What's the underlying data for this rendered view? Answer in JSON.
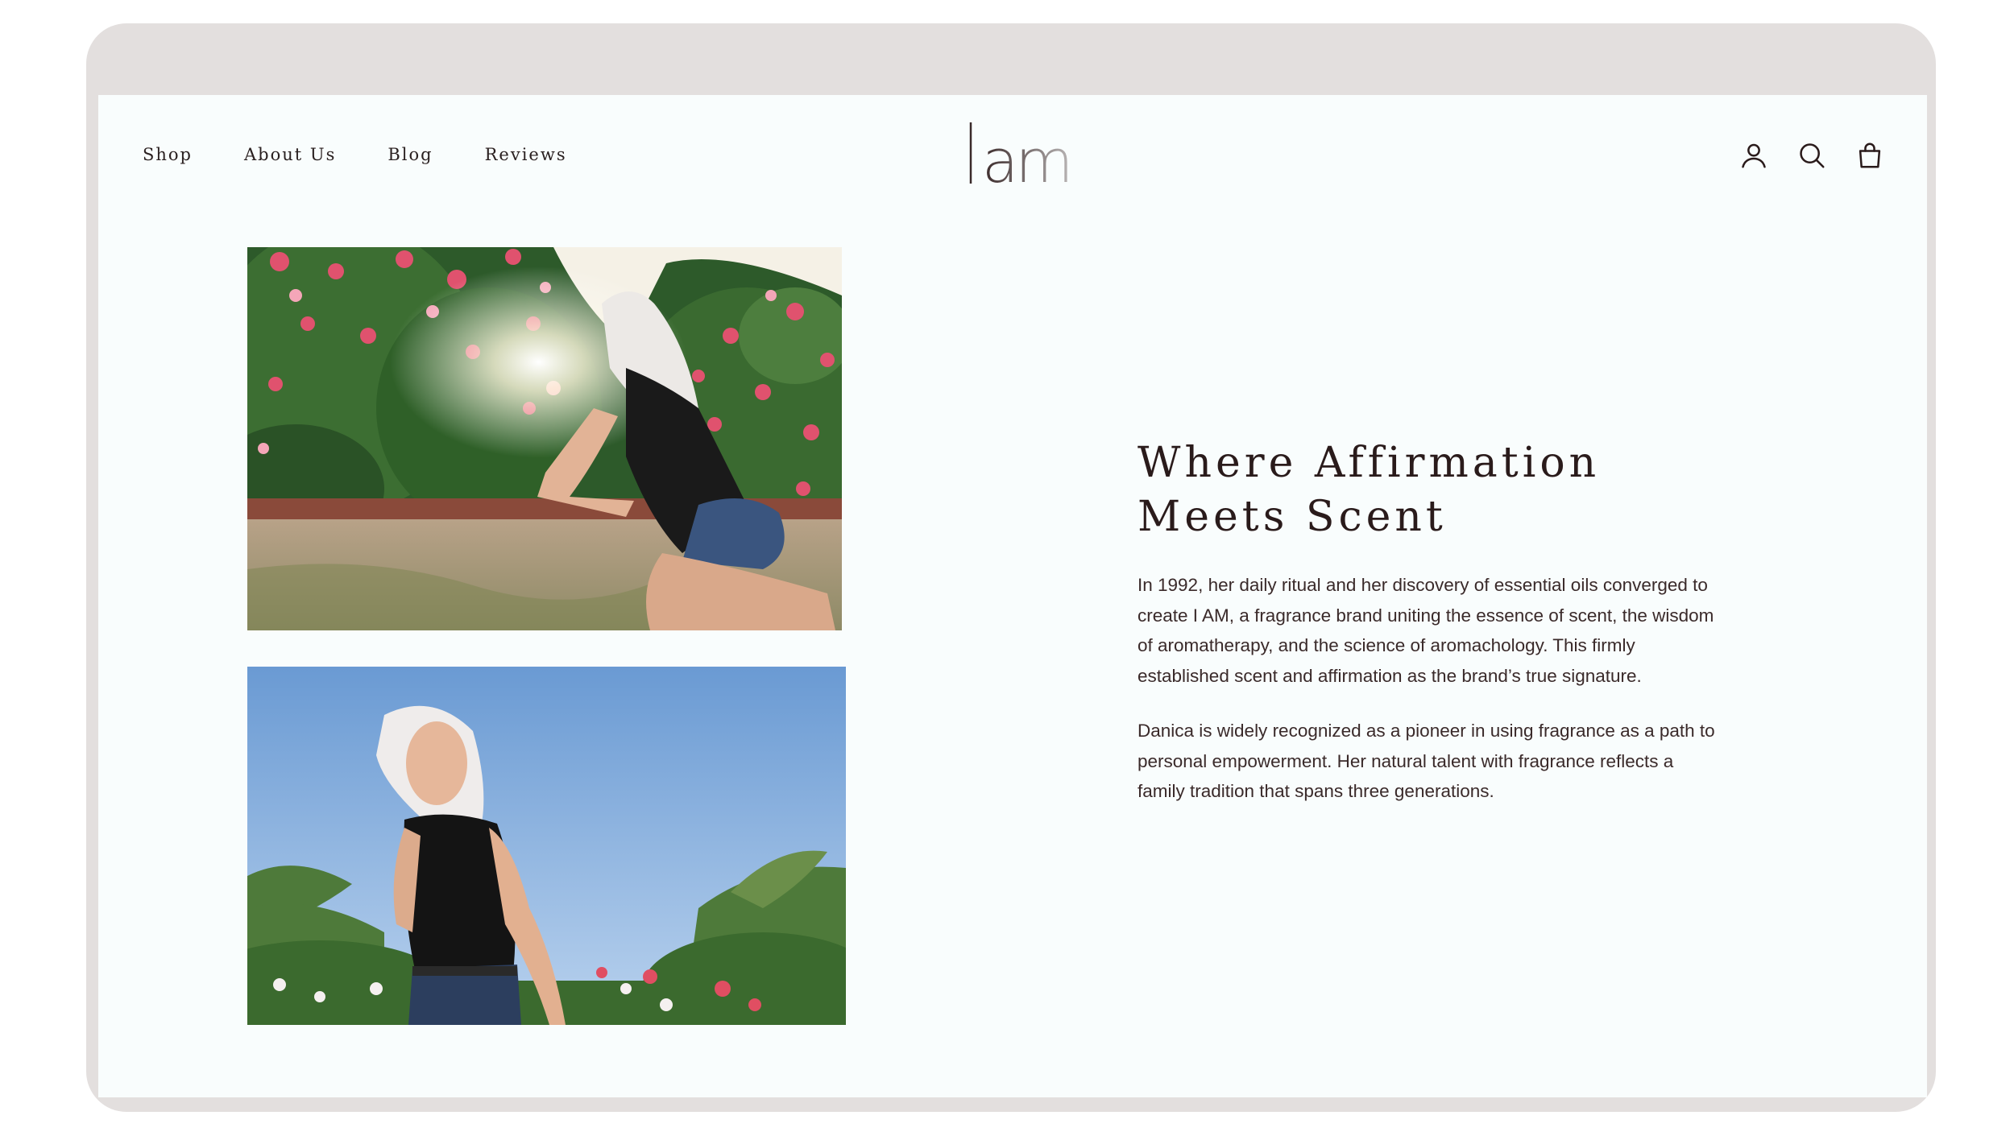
{
  "header": {
    "nav": [
      "Shop",
      "About Us",
      "Blog",
      "Reviews"
    ],
    "logo_text": "I am",
    "icons": [
      "account-icon",
      "search-icon",
      "bag-icon"
    ]
  },
  "content": {
    "heading_line1": "Where Affirmation",
    "heading_line2": "Meets Scent",
    "paragraph1": "In 1992, her daily ritual and her discovery of essential oils converged to create I AM, a fragrance brand uniting the essence of scent, the wisdom of aromatherapy, and the science of aromachology. This firmly established scent and affirmation as the brand’s true signature.",
    "paragraph2": "Danica is widely recognized as a pioneer in using fragrance as a path to personal empowerment. Her natural talent with fragrance reflects a family tradition that spans three generations."
  },
  "colors": {
    "device_frame": "#e3dfde",
    "screen_bg": "#f9fdfd",
    "text_dark": "#2a1b1b"
  }
}
